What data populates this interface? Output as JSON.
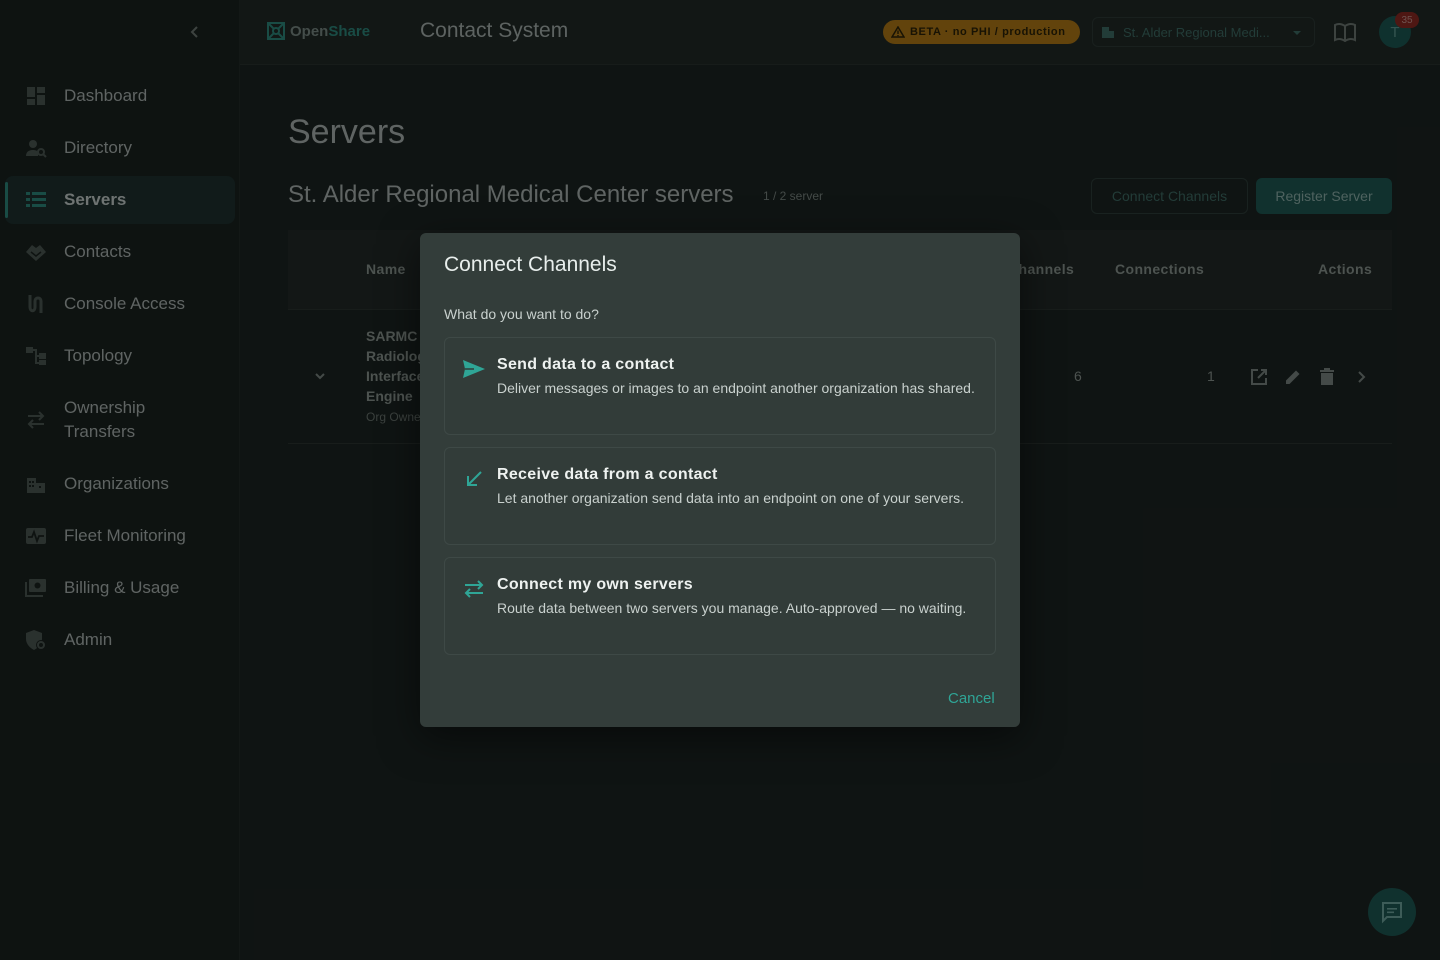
{
  "sidebar": {
    "items": [
      {
        "label": "Dashboard",
        "icon": "dashboard-icon"
      },
      {
        "label": "Directory",
        "icon": "person-search-icon"
      },
      {
        "label": "Servers",
        "icon": "servers-list-icon",
        "active": true
      },
      {
        "label": "Contacts",
        "icon": "handshake-icon"
      },
      {
        "label": "Console Access",
        "icon": "console-access-icon"
      },
      {
        "label": "Topology",
        "icon": "topology-icon"
      },
      {
        "label": "Ownership Transfers",
        "icon": "transfer-arrows-icon"
      },
      {
        "label": "Organizations",
        "icon": "building-icon"
      },
      {
        "label": "Fleet Monitoring",
        "icon": "monitor-heart-icon"
      },
      {
        "label": "Billing & Usage",
        "icon": "billing-icon"
      },
      {
        "label": "Admin",
        "icon": "admin-shield-icon"
      }
    ]
  },
  "header": {
    "brand_part1": "Open",
    "brand_part2": "Share",
    "title": "Contact System",
    "beta_badge": "BETA · no PHI / production",
    "org_select_value": "St. Alder Regional Medi...",
    "avatar_initial": "T",
    "notification_count": "35"
  },
  "main": {
    "page_title": "Servers",
    "section_title": "St. Alder Regional Medical Center servers",
    "count_badge": "1 / 2 server",
    "connect_button": "Connect Channels",
    "register_button": "Register Server",
    "table": {
      "columns": {
        "name": "Name",
        "channels": "Channels",
        "connections": "Connections",
        "actions": "Actions"
      },
      "rows": [
        {
          "name": "SARMC Radiology Interface Engine",
          "owner": "Org Owner",
          "channels": "6",
          "connections": "1"
        }
      ]
    }
  },
  "dialog": {
    "title": "Connect Channels",
    "subtitle": "What do you want to do?",
    "options": [
      {
        "title": "Send data to a contact",
        "description": "Deliver messages or images to an endpoint another organization has shared.",
        "icon": "send-icon"
      },
      {
        "title": "Receive data from a contact",
        "description": "Let another organization send data into an endpoint on one of your servers.",
        "icon": "arrow-down-left-icon"
      },
      {
        "title": "Connect my own servers",
        "description": "Route data between two servers you manage. Auto-approved — no waiting.",
        "icon": "swap-arrows-icon"
      }
    ],
    "cancel_label": "Cancel"
  },
  "colors": {
    "accent": "#2fa596",
    "warning_badge": "#b27a16",
    "dialog_bg": "#333d3a"
  }
}
